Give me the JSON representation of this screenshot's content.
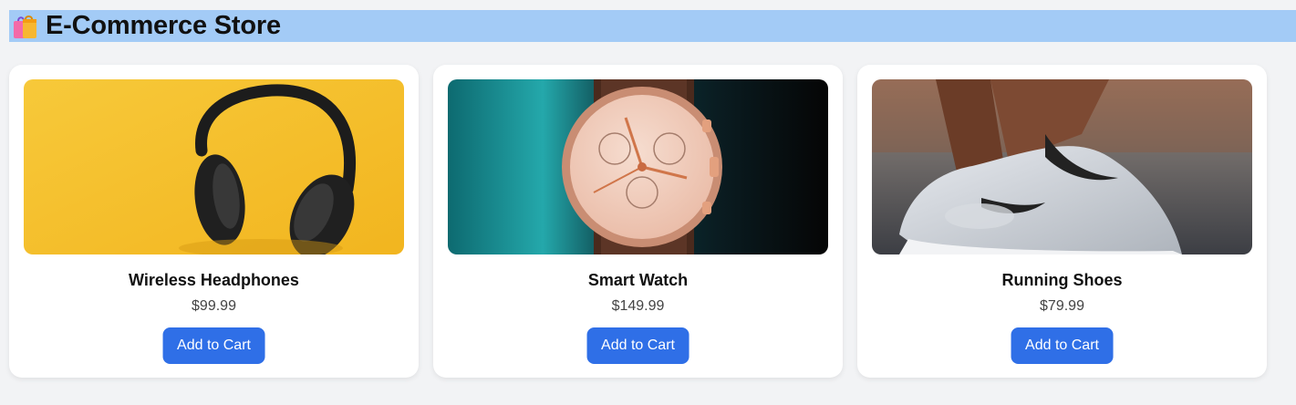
{
  "header": {
    "title": "E-Commerce Store",
    "icon": "shopping-bags-icon",
    "background": "#a3cbf6"
  },
  "products": [
    {
      "name": "Wireless Headphones",
      "price": "$99.99",
      "button_label": "Add to Cart",
      "image_icon": "headphones-image"
    },
    {
      "name": "Smart Watch",
      "price": "$149.99",
      "button_label": "Add to Cart",
      "image_icon": "watch-image"
    },
    {
      "name": "Running Shoes",
      "price": "$79.99",
      "button_label": "Add to Cart",
      "image_icon": "shoe-image"
    }
  ],
  "colors": {
    "accent": "#2f6fe7",
    "page_background": "#f2f3f5",
    "card_background": "#ffffff"
  }
}
